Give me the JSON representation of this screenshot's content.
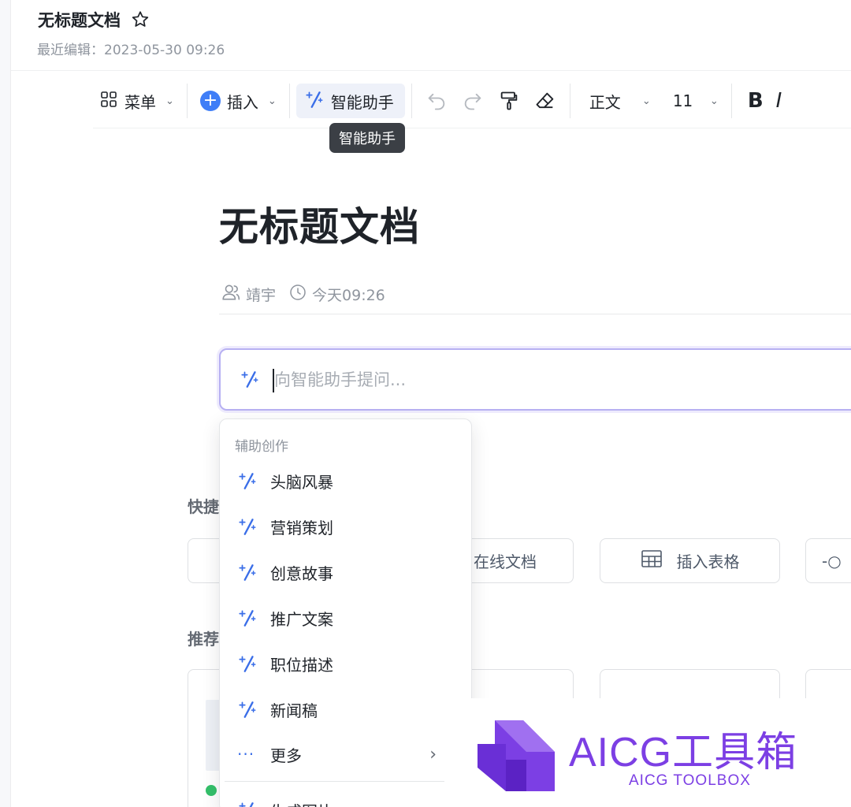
{
  "header": {
    "title": "无标题文档",
    "last_edit": "最近编辑：2023-05-30 09:26"
  },
  "toolbar": {
    "menu_label": "菜单",
    "insert_label": "插入",
    "ai_label": "智能助手",
    "tooltip": "智能助手",
    "style_label": "正文",
    "font_size": "11",
    "bold_label": "B"
  },
  "doc": {
    "title": "无标题文档",
    "author": "靖宇",
    "time": "今天09:26"
  },
  "ask": {
    "placeholder": "向智能助手提问..."
  },
  "quick": {
    "label": "快捷",
    "cards": [
      "在线文档",
      "插入表格"
    ]
  },
  "recommend": {
    "label": "推荐"
  },
  "menu": {
    "header": "辅助创作",
    "items": [
      "头脑风暴",
      "营销策划",
      "创意故事",
      "推广文案",
      "职位描述",
      "新闻稿"
    ],
    "more": "更多",
    "next_section": "生成图片"
  },
  "watermark": {
    "title": "AICG工具箱",
    "subtitle": "AICG TOOLBOX"
  },
  "colors": {
    "accent": "#3f7ef7",
    "ai_blue": "#3a6ee8",
    "brand_purple": "#7c3fe4"
  }
}
